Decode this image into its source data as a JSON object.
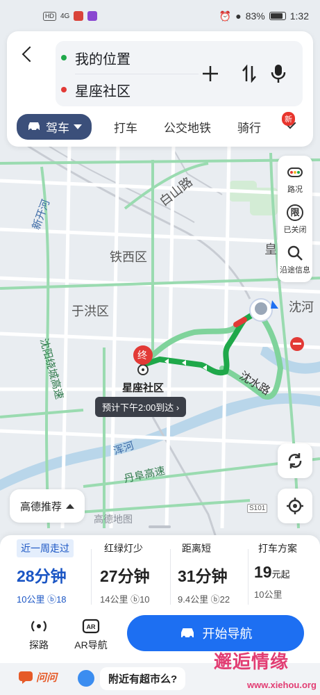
{
  "status_bar": {
    "left_chips": [
      "HD",
      "4G",
      "",
      ""
    ],
    "battery": "83%",
    "time": "1:32"
  },
  "route_inputs": {
    "start": "我的位置",
    "end": "星座社区"
  },
  "transport_tabs": {
    "active": "驾车",
    "items": [
      "打车",
      "公交地铁",
      "骑行"
    ],
    "new_badge": "新"
  },
  "map_tools": {
    "traffic": "路况",
    "restriction": "已关闭",
    "restriction_char": "限",
    "along_search": "沿途信息"
  },
  "map_labels": {
    "baishan_road": "白山路",
    "tiexi_district": "铁西区",
    "yuhong_district": "于洪区",
    "xinkai_river": "新开河",
    "ring_highway": "沈阳绕城高速",
    "hunhe": "浑河",
    "fuhuang_highway": "丹阜高速",
    "shenshui_road": "沈水路",
    "shenhe": "沈河",
    "huang": "皇",
    "dest_badge": "终",
    "dest_name": "星座社区",
    "eta": "预计下午2:00到达 ›",
    "map_brand": "高德地图",
    "road_code": "S101"
  },
  "recommend_button": "高德推荐",
  "routes": [
    {
      "tag": "近一周走过",
      "time": "28分钟",
      "unit": "",
      "meta": "10公里 ⓑ18",
      "selected": true
    },
    {
      "tag": "红绿灯少",
      "time": "27分钟",
      "unit": "",
      "meta": "14公里 ⓑ10",
      "selected": false
    },
    {
      "tag": "距离短",
      "time": "31分钟",
      "unit": "",
      "meta": "9.4公里 ⓑ22",
      "selected": false
    },
    {
      "tag": "打车方案",
      "time": "19",
      "unit": "元起",
      "meta": "10公里",
      "selected": false
    }
  ],
  "actions": {
    "explore": "探路",
    "ar_nav": "AR导航",
    "start_nav": "开始导航"
  },
  "ask": {
    "label": "问问",
    "question": "附近有超市么?"
  },
  "watermark": {
    "text": "邂逅情缘",
    "url": "www.xiehou.org"
  },
  "colors": {
    "route_selected": "#1fa84a",
    "route_alt": "#7fd39b",
    "primary_blue": "#1d6ff2",
    "active_tab": "#3b4f7a",
    "dest_red": "#e23a36"
  }
}
